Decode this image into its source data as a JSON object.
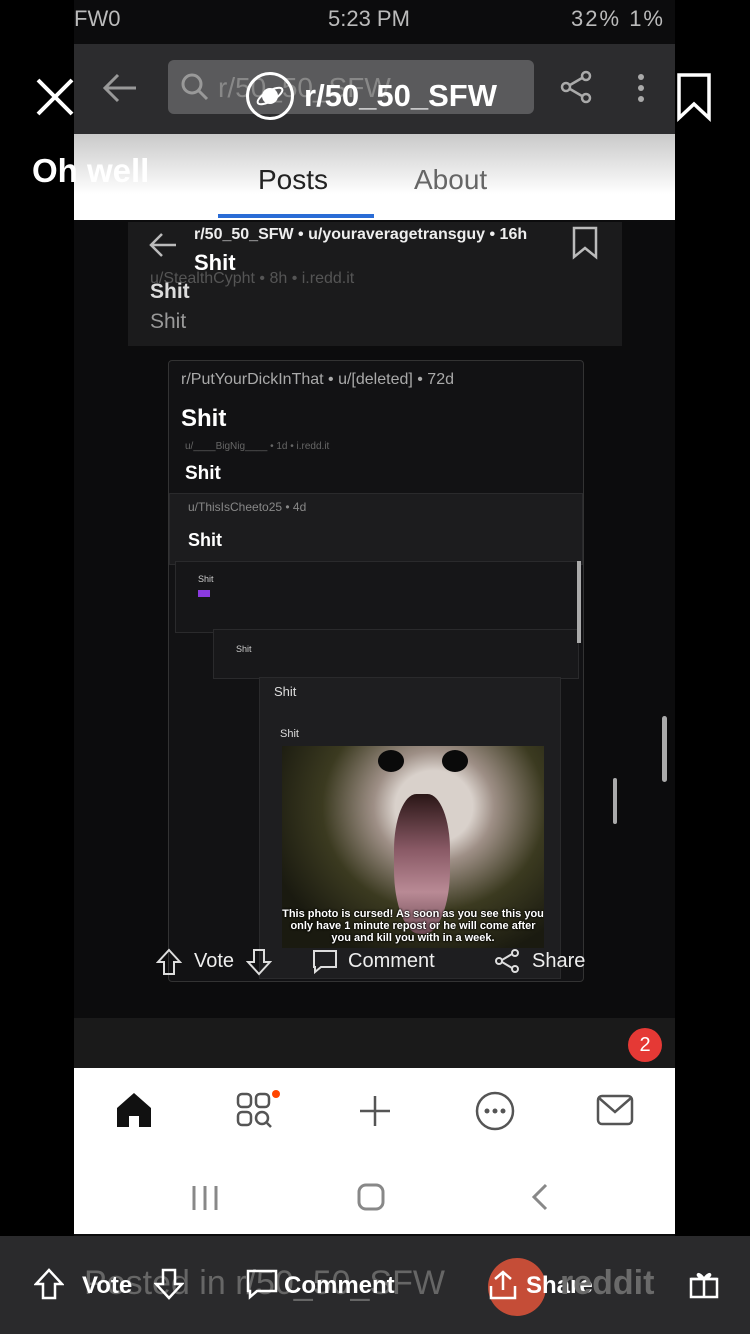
{
  "status": {
    "left": "FW0",
    "time": "5:23 PM",
    "right": "32% 1%"
  },
  "toolbar": {
    "search_placeholder": "r/50_50_SFW"
  },
  "overlay": {
    "subreddit_title": "r/50_50_SFW",
    "caption": "Oh well"
  },
  "tabs": [
    {
      "label": "Posts"
    },
    {
      "label": "About"
    }
  ],
  "post_header": {
    "meta": "r/50_50_SFW • u/youraveragetransguy • 16h",
    "title": "Shit",
    "sub_meta": "u/StealthCypht • 8h • i.redd.it",
    "line2": "Shit",
    "line3": "Shit"
  },
  "embedded": {
    "meta1": "r/PutYourDickInThat • u/[deleted] • 72d",
    "title1": "Shit",
    "meta2": "u/____BigNig____ • 1d • i.redd.it",
    "title2": "Shit",
    "meta3": "u/ThisIsCheeto25 • 4d",
    "title3": "Shit",
    "small1": "Shit",
    "small2": "Shit",
    "small3": "Shit",
    "small4": "Shit",
    "cursed_text": "This photo is cursed! As soon as you see this you only have 1 minute repost or he will come after you and kill you with in a week."
  },
  "actions": {
    "vote": "Vote",
    "comment": "Comment",
    "share": "Share"
  },
  "bottom_nav": {
    "badge_count": "2"
  },
  "footer": {
    "posted_in": "Posted in r/50_50_SFW",
    "vote": "Vote",
    "comment": "Comment",
    "share": "Share",
    "brand": "reddit"
  }
}
